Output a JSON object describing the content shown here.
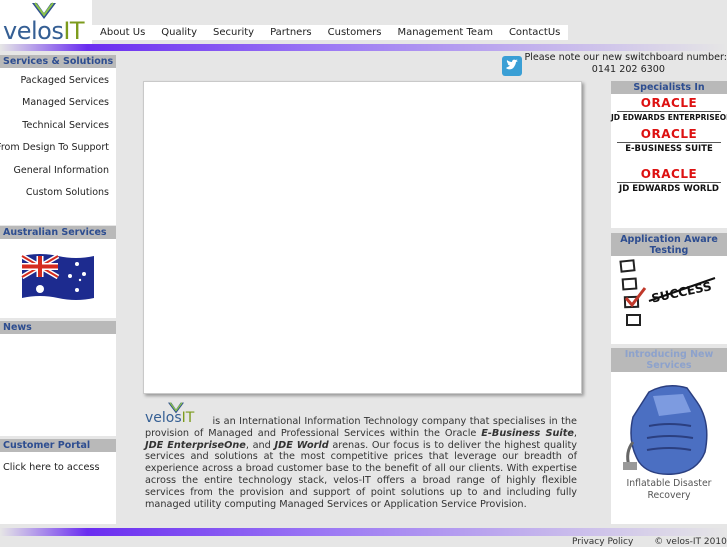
{
  "logo": {
    "part1": "velos",
    "part2": "IT"
  },
  "nav": [
    {
      "label": "About Us"
    },
    {
      "label": "Quality"
    },
    {
      "label": "Security"
    },
    {
      "label": "Partners"
    },
    {
      "label": "Customers"
    },
    {
      "label": "Management Team"
    },
    {
      "label": "ContactUs"
    }
  ],
  "notice": {
    "line1": "Please note our new switchboard number:",
    "phone": "0141 202 6300"
  },
  "icons": {
    "twitter": "twitter-icon",
    "flag": "australian-flag-icon",
    "success": "success-checklist-icon",
    "server": "inflatable-server-icon"
  },
  "left": {
    "services_heading": "Services & Solutions",
    "services": [
      {
        "label": "Packaged Services"
      },
      {
        "label": "Managed Services"
      },
      {
        "label": "Technical Services"
      },
      {
        "label": "From Design To Support"
      },
      {
        "label": "General Information"
      },
      {
        "label": "Custom Solutions"
      }
    ],
    "australian_heading": "Australian Services",
    "news_heading": "News",
    "portal_heading": "Customer Portal",
    "portal_link": "Click here to access"
  },
  "intro": {
    "t1": "is an International Information Technology company that specialises in the provision of Managed and Professional Services within the Oracle",
    "b1": "E-Business Suite",
    "t2": ",",
    "b2": "JDE EnterpriseOne",
    "t3": ", and",
    "b3": "JDE World",
    "t4": "arenas. Our focus is to deliver the highest quality services and solutions at the most competitive prices that leverage our breadth of experience across a broad customer base to the benefit of all our clients. With expertise across the entire technology stack, velos-IT offers a broad range of highly flexible services from the provision and support of point solutions up to and including fully managed utility computing Managed Services or Application Service Provision."
  },
  "right": {
    "specialists_heading": "Specialists In",
    "oracle_word": "ORACLE",
    "products": [
      {
        "label": "JD EDWARDS ENTERPRISEONE"
      },
      {
        "label": "E-BUSINESS SUITE"
      },
      {
        "label": "JD EDWARDS WORLD"
      }
    ],
    "testing_heading": "Application Aware Testing",
    "success_word": "SUCCESS",
    "new_heading": "Introducing New Services",
    "new_caption": "Inflatable Disaster Recovery"
  },
  "footer": {
    "privacy": "Privacy Policy",
    "copyright": "© velos-IT 2010"
  },
  "colors": {
    "heading_bg": "#b9b9b9",
    "heading_text": "#2d4d90",
    "accent_purple": "#6a2df0",
    "logo_blue": "#355f94",
    "logo_green": "#7c9b1c",
    "oracle_red": "#dd1111"
  }
}
